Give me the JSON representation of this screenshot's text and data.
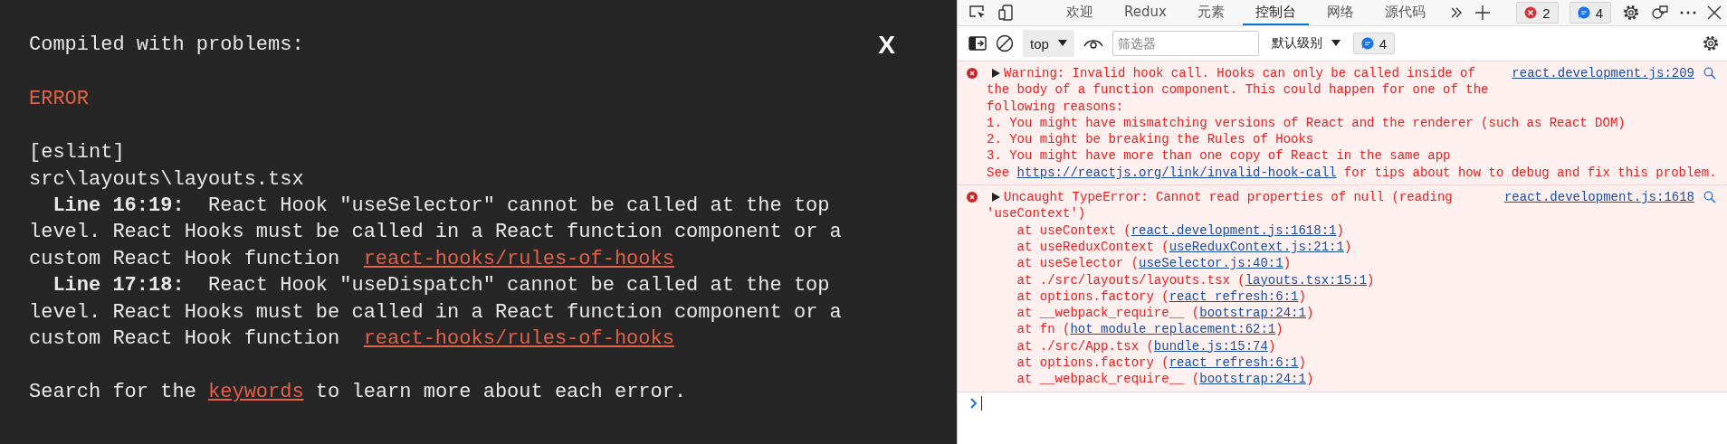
{
  "overlay": {
    "title": "Compiled with problems:",
    "close": "X",
    "error_label": "ERROR",
    "source": "[eslint]",
    "file": "src\\layouts\\layouts.tsx",
    "problems": [
      {
        "location": "Line 16:19:",
        "message": "React Hook \"useSelector\" cannot be called at the top level. React Hooks must be called in a React function component or a custom React Hook function",
        "rule": "react-hooks/rules-of-hooks"
      },
      {
        "location": "Line 17:18:",
        "message": "React Hook \"useDispatch\" cannot be called at the top level. React Hooks must be called in a React function component or a custom React Hook function",
        "rule": "react-hooks/rules-of-hooks"
      }
    ],
    "footer": {
      "before": "Search for the ",
      "link": "keywords",
      "after": " to learn more about each error."
    }
  },
  "devtools": {
    "tabs": [
      {
        "label": "欢迎",
        "selected": false
      },
      {
        "label": "Redux",
        "selected": false
      },
      {
        "label": "元素",
        "selected": false
      },
      {
        "label": "控制台",
        "selected": true
      },
      {
        "label": "网络",
        "selected": false
      },
      {
        "label": "源代码",
        "selected": false
      }
    ],
    "error_count": "2",
    "message_count": "4",
    "toolbar": {
      "context": "top",
      "filter_placeholder": "筛选器",
      "levels": "默认级别",
      "message_count": "4"
    },
    "messages": [
      {
        "kind": "error",
        "expanded": false,
        "source": "react.development.js:209",
        "lines": [
          [
            {
              "text": "Warning: Invalid hook call. Hooks can only be called inside of",
              "link": false
            }
          ],
          [
            {
              "text": "the body of a function component. This could happen for one of the",
              "link": false
            }
          ],
          [
            {
              "text": "following reasons:",
              "link": false
            }
          ],
          [
            {
              "text": "1. You might have mismatching versions of React and the renderer (such as React DOM)",
              "link": false
            }
          ],
          [
            {
              "text": "2. You might be breaking the Rules of Hooks",
              "link": false
            }
          ],
          [
            {
              "text": "3. You might have more than one copy of React in the same app",
              "link": false
            }
          ],
          [
            {
              "text": "See ",
              "link": false
            },
            {
              "text": "https://reactjs.org/link/invalid-hook-call",
              "link": true
            },
            {
              "text": " for tips about how to debug and fix this problem.",
              "link": false
            }
          ]
        ]
      },
      {
        "kind": "error",
        "expanded": false,
        "source": "react.development.js:1618",
        "lines": [
          [
            {
              "text": "Uncaught TypeError: Cannot read properties of null (reading",
              "link": false
            }
          ],
          [
            {
              "text": "'useContext')",
              "link": false
            }
          ],
          [
            {
              "text": "    at useContext (",
              "link": false
            },
            {
              "text": "react.development.js:1618:1",
              "link": true
            },
            {
              "text": ")",
              "link": false
            }
          ],
          [
            {
              "text": "    at useReduxContext (",
              "link": false
            },
            {
              "text": "useReduxContext.js:21:1",
              "link": true
            },
            {
              "text": ")",
              "link": false
            }
          ],
          [
            {
              "text": "    at useSelector (",
              "link": false
            },
            {
              "text": "useSelector.js:40:1",
              "link": true
            },
            {
              "text": ")",
              "link": false
            }
          ],
          [
            {
              "text": "    at ./src/layouts/layouts.tsx (",
              "link": false
            },
            {
              "text": "layouts.tsx:15:1",
              "link": true
            },
            {
              "text": ")",
              "link": false
            }
          ],
          [
            {
              "text": "    at options.factory (",
              "link": false
            },
            {
              "text": "react refresh:6:1",
              "link": true
            },
            {
              "text": ")",
              "link": false
            }
          ],
          [
            {
              "text": "    at __webpack_require__ (",
              "link": false
            },
            {
              "text": "bootstrap:24:1",
              "link": true
            },
            {
              "text": ")",
              "link": false
            }
          ],
          [
            {
              "text": "    at fn (",
              "link": false
            },
            {
              "text": "hot module replacement:62:1",
              "link": true
            },
            {
              "text": ")",
              "link": false
            }
          ],
          [
            {
              "text": "    at ./src/App.tsx (",
              "link": false
            },
            {
              "text": "bundle.js:15:74",
              "link": true
            },
            {
              "text": ")",
              "link": false
            }
          ],
          [
            {
              "text": "    at options.factory (",
              "link": false
            },
            {
              "text": "react refresh:6:1",
              "link": true
            },
            {
              "text": ")",
              "link": false
            }
          ],
          [
            {
              "text": "    at __webpack_require__ (",
              "link": false
            },
            {
              "text": "bootstrap:24:1",
              "link": true
            },
            {
              "text": ")",
              "link": false
            }
          ]
        ]
      }
    ]
  }
}
